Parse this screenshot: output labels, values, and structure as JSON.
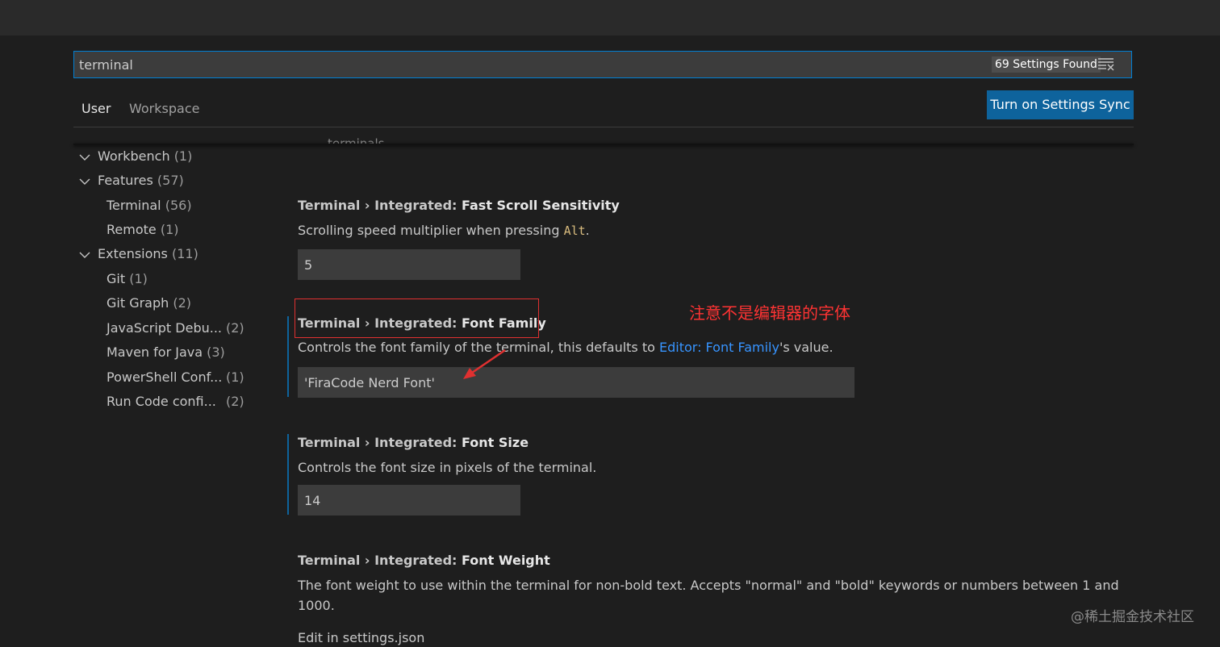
{
  "search": {
    "value": "terminal",
    "result_count": "69 Settings Found",
    "clear_icon": "clear-filter-icon"
  },
  "tabs": [
    {
      "label": "User",
      "active": true
    },
    {
      "label": "Workspace",
      "active": false
    }
  ],
  "sync_button": "Turn on Settings Sync",
  "cut_off_text": "terminals.",
  "toc": {
    "workbench": {
      "label": "Workbench",
      "count": "(1)"
    },
    "features": {
      "label": "Features",
      "count": "(57)"
    },
    "terminal": {
      "label": "Terminal",
      "count": "(56)"
    },
    "remote": {
      "label": "Remote",
      "count": "(1)"
    },
    "extensions": {
      "label": "Extensions",
      "count": "(11)"
    },
    "git": {
      "label": "Git",
      "count": "(1)"
    },
    "git_graph": {
      "label": "Git Graph",
      "count": "(2)"
    },
    "javascript": {
      "label": "JavaScript Debu...",
      "count": "(2)"
    },
    "maven": {
      "label": "Maven for Java",
      "count": "(3)"
    },
    "powershell": {
      "label": "PowerShell Conf...",
      "count": "(1)"
    },
    "runcode": {
      "label": "Run Code confi...",
      "count": "(2)"
    }
  },
  "settings": {
    "fast_scroll": {
      "category": "Terminal › Integrated: ",
      "name": "Fast Scroll Sensitivity",
      "desc_prefix": "Scrolling speed multiplier when pressing ",
      "desc_code": "Alt",
      "desc_suffix": ".",
      "value": "5"
    },
    "font_family": {
      "category": "Terminal › Integrated: ",
      "name": "Font Family",
      "desc_prefix": "Controls the font family of the terminal, this defaults to ",
      "desc_link": "Editor: Font Family",
      "desc_suffix": "'s value.",
      "value": "'FiraCode Nerd Font'"
    },
    "font_size": {
      "category": "Terminal › Integrated: ",
      "name": "Font Size",
      "desc": "Controls the font size in pixels of the terminal.",
      "value": "14"
    },
    "font_weight": {
      "category": "Terminal › Integrated: ",
      "name": "Font Weight",
      "desc": "The font weight to use within the terminal for non-bold text. Accepts \"normal\" and \"bold\" keywords or numbers between 1 and 1000."
    }
  },
  "edit_link": "Edit in settings.json",
  "annotation": "注意不是编辑器的字体",
  "watermark": "@稀土掘金技术社区",
  "colors": {
    "accent": "#007fd4",
    "button": "#0e639c",
    "annotation": "#e03030",
    "link": "#3794ff"
  }
}
